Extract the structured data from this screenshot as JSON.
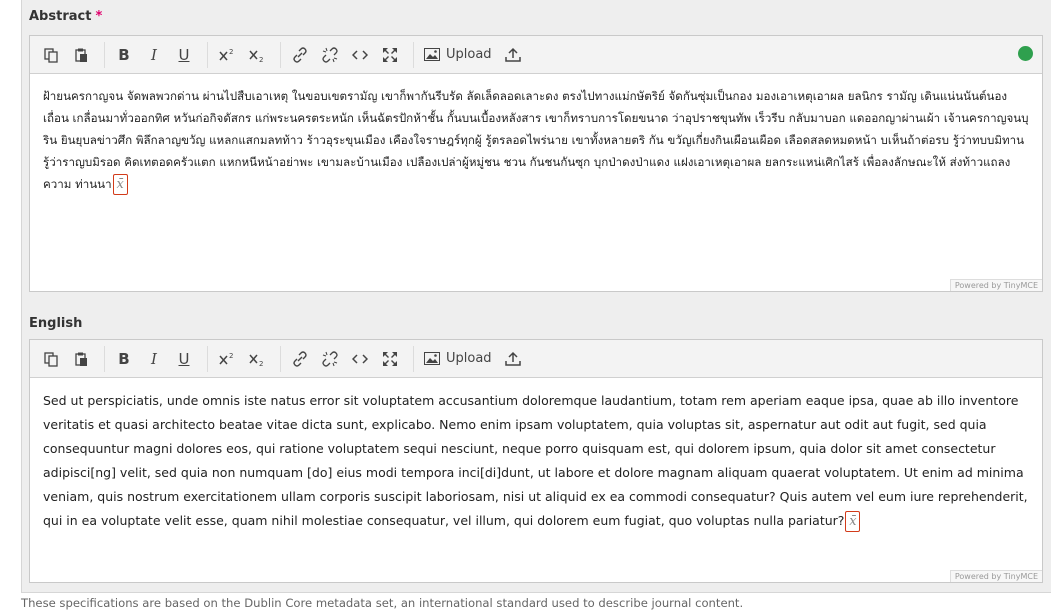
{
  "abstract": {
    "label": "Abstract",
    "required_mark": "*",
    "text": "ฝ้ายนครกาญจน จัดพลพวกด่าน ผ่านไปสืบเอาเหตุ ในขอบเขตรามัญ เขาก็พากันรีบรัด ลัดเล็ดลอดเลาะดง ตรงไปทางแม่กษัตริย์ จัดกันซุ่มเป็นกอง มองเอาเหตุเอาผล ยลนิกร รามัญ เดินแน่นนันต์นองเถื่อน เกลื่อนมาทั่วออกทิศ หวันก่อกิจดัสกร แก่พระนครตระหนัก เห็นฉัตรปักห้าชั้น กั้นบนเบื้องหลังสาร เขาก็ทราบการโดยขนาด ว่าอุปราชขุนทัพ เร็วรีบ กลับมาบอก แดออกญาผ่านเผ้า เจ้านครกาญจนบุริน ยินยุบลข่าวศึก พิลึกลาญขวัญ แหลกแสกมลทท้าว ร้าวอุระขุนเมือง เคืองใจราษฎร์ทุกผู้ รู้ตรลอดไพร่นาย เขาทั้งหลายตริ กัน ขวัญเกี่ยงกินเผือนเผือด เลือดสลดหมดหน้า บเห็นถ้าต่อรบ รู้ว่าทบบมิทาน รู้ว่าราญบมิรอด คิดเทตอดครัวแตก แหกหนีหน้าอย่าพะ เขามละบ้านเมือง เปลืองเปล่าผู้หมู่ชน ชวน กันชนกันซุก บุกป่าดงป่าแดง แฝงเอาเหตุเอาผล ยลกระแหน่เศิกไสร้ เพื่อลงลักษณะให้ ส่งท้าวแถลงความ ท่านนา",
    "powered_by": "Powered by TinyMCE"
  },
  "english": {
    "label": "English",
    "text": "Sed ut perspiciatis, unde omnis iste natus error sit voluptatem accusantium doloremque laudantium, totam rem aperiam eaque ipsa, quae ab illo inventore veritatis et quasi architecto beatae vitae dicta sunt, explicabo. Nemo enim ipsam voluptatem, quia voluptas sit, aspernatur aut odit aut fugit, sed quia consequuntur magni dolores eos, qui ratione voluptatem sequi nesciunt, neque porro quisquam est, qui dolorem ipsum, quia dolor sit amet consectetur adipisci[ng] velit, sed quia non numquam [do] eius modi tempora inci[di]dunt, ut labore et dolore magnam aliquam quaerat voluptatem. Ut enim ad minima veniam, quis nostrum exercitationem ullam corporis suscipit laboriosam, nisi ut aliquid ex ea commodi consequatur? Quis autem vel eum iure reprehenderit, qui in ea voluptate velit esse, quam nihil molestiae consequatur, vel illum, qui dolorem eum fugiat, quo voluptas nulla pariatur?",
    "powered_by": "Powered by TinyMCE"
  },
  "toolbar": {
    "bold": "B",
    "italic": "I",
    "underline": "U",
    "upload_label": "Upload"
  },
  "help_text": "These specifications are based on the Dublin Core metadata set, an international standard used to describe journal content.",
  "colors": {
    "required": "#e0006c",
    "globe": "#2fa04e",
    "formula_border": "#d23b1a"
  }
}
